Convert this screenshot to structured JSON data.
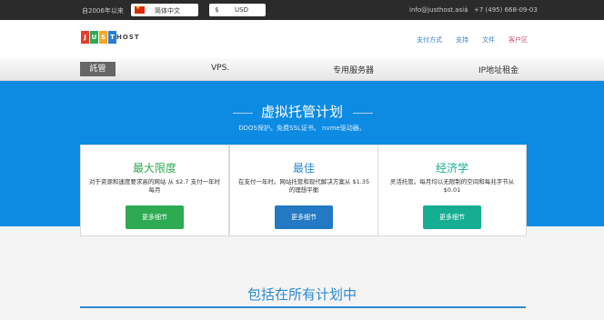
{
  "topbar": {
    "since": "自2006年以来",
    "language": "简体中文",
    "currency_symbol": "$",
    "currency": "USD",
    "email": "info@justhost.asia",
    "separator": "|",
    "phone": "+7 (495) 668-09-03"
  },
  "logo": {
    "letters": [
      "J",
      "U",
      "S",
      "T"
    ],
    "rest": "HOST",
    "colors": [
      "#e43d30",
      "#33a853",
      "#f5a623",
      "#2a7dd4"
    ]
  },
  "header_links": [
    "支付方式",
    "支持",
    "文件",
    "客户区"
  ],
  "menu": {
    "active": "託管",
    "items": [
      "VPS.",
      "专用服务器",
      "IP地址租金"
    ]
  },
  "hero": {
    "title": "虚拟托管计划",
    "subtitle": "DDOS保护。免费SSL证书。 nvme驱动器。"
  },
  "cards": [
    {
      "title": "最大限度",
      "desc": "对于资源和速度要求高的网站 从 $2.7 支付一年时每月",
      "button": "更多细节",
      "color": "#2eaa52",
      "title_color": "#2eaa52"
    },
    {
      "title": "最佳",
      "desc": "在支付一年时。网站托管和现代解决方案从 $1.35的理想平衡",
      "button": "更多细节",
      "color": "#2379c3",
      "title_color": "#2b8ad3"
    },
    {
      "title": "经济学",
      "desc": "灵活托管。每月均以无限制的空间和每兆字节从 $0.01",
      "button": "更多细节",
      "color": "#16ae93",
      "title_color": "#16ae93"
    }
  ],
  "lower": {
    "title": "包括在所有计划中"
  }
}
